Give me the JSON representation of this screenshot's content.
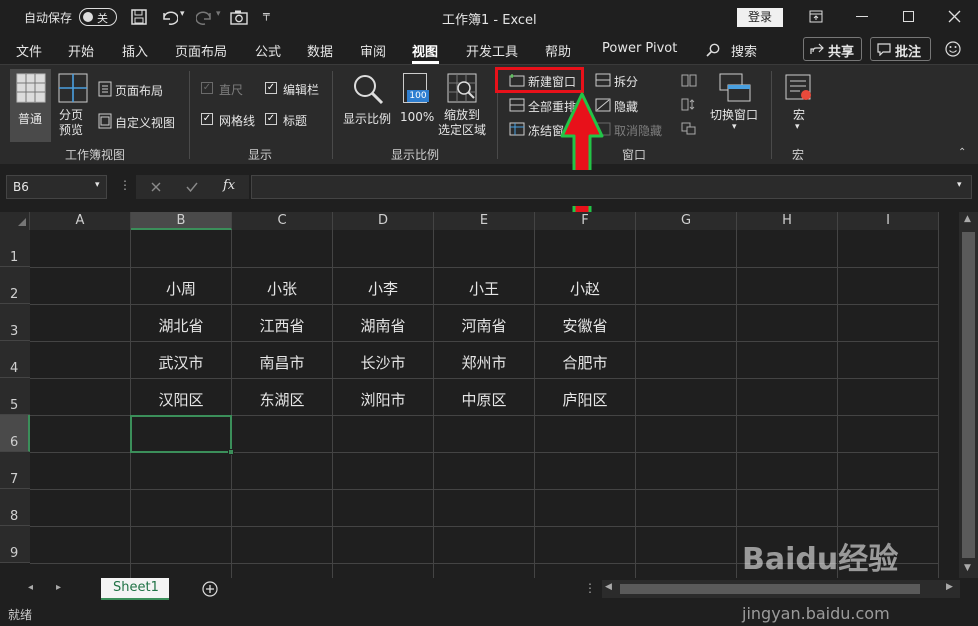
{
  "titlebar": {
    "autosave_label": "自动保存",
    "autosave_state": "关",
    "title": "工作簿1 - Excel",
    "login_label": "登录"
  },
  "tabs": [
    "文件",
    "开始",
    "插入",
    "页面布局",
    "公式",
    "数据",
    "审阅",
    "视图",
    "开发工具",
    "帮助",
    "Power Pivot"
  ],
  "active_tab": "视图",
  "search_label": "搜索",
  "share_label": "共享",
  "comment_label": "批注",
  "ribbon": {
    "workbook_views": {
      "group_label": "工作簿视图",
      "normal": "普通",
      "page_break": "分页\n预览",
      "page_break_l1": "分页",
      "page_break_l2": "预览",
      "page_layout": "页面布局",
      "custom_view": "自定义视图"
    },
    "show": {
      "group_label": "显示",
      "ruler": "直尺",
      "formula_bar": "编辑栏",
      "gridlines": "网格线",
      "headings": "标题"
    },
    "zoom": {
      "group_label": "显示比例",
      "zoom": "显示比例",
      "hundred": "100%",
      "hundred_icon": "100",
      "zoom_selection_l1": "缩放到",
      "zoom_selection_l2": "选定区域"
    },
    "window": {
      "group_label": "窗口",
      "new_window": "新建窗口",
      "arrange_all": "全部重排",
      "freeze_panes": "冻结窗格",
      "split": "拆分",
      "hide": "隐藏",
      "unhide": "取消隐藏",
      "switch_windows": "切换窗口"
    },
    "macros": {
      "group_label": "宏",
      "macros": "宏"
    }
  },
  "formula_bar": {
    "name_box": "B6",
    "fx": "fx",
    "formula": ""
  },
  "columns": [
    "A",
    "B",
    "C",
    "D",
    "E",
    "F",
    "G",
    "H",
    "I"
  ],
  "rows": [
    "1",
    "2",
    "3",
    "4",
    "5",
    "6",
    "7",
    "8",
    "9"
  ],
  "table": [
    [
      "小周",
      "小张",
      "小李",
      "小王",
      "小赵"
    ],
    [
      "湖北省",
      "江西省",
      "湖南省",
      "河南省",
      "安徽省"
    ],
    [
      "武汉市",
      "南昌市",
      "长沙市",
      "郑州市",
      "合肥市"
    ],
    [
      "汉阳区",
      "东湖区",
      "浏阳市",
      "中原区",
      "庐阳区"
    ]
  ],
  "sheet_tab": "Sheet1",
  "status_text": "就绪",
  "watermark": {
    "brand": "Baidu经验",
    "url": "jingyan.baidu.com"
  },
  "colors": {
    "accent_green": "#3b8f5a",
    "highlight_red": "#e8111a",
    "arrow_green": "#22c447"
  }
}
